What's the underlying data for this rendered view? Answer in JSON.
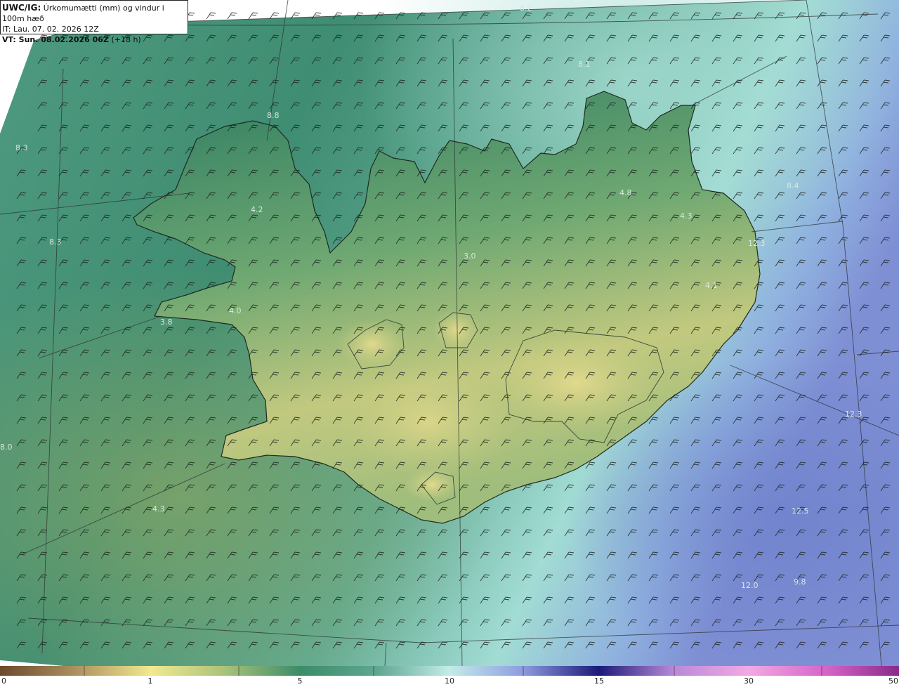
{
  "header": {
    "model": "UWC/IG:",
    "description": "Úrkomumætti (mm) og vindur i 100m hæð",
    "issue_time": "IT: Lau. 07. 02. 2026 12Z",
    "valid_time_bold": "VT: Sun. 08.02.2026 06Z",
    "lead": "(+18 h)"
  },
  "legend": {
    "ticks": [
      "0",
      "1",
      "5",
      "10",
      "15",
      "30",
      "50"
    ]
  },
  "map": {
    "values": [
      "8.2",
      "8.1",
      "8.3",
      "4.8",
      "4.2",
      "8.3",
      "4.3",
      "3.0",
      "8.4",
      "4.1",
      "4.0",
      "3.8",
      "12.3",
      "4.3",
      "12.5",
      "12.0",
      "9.8",
      "8.0",
      "8.8",
      "12.3"
    ]
  },
  "colors": {
    "land_dark": "#2f7a60",
    "land_mid": "#4c9272",
    "land_light": "#b6c77c",
    "land_high": "#d9d68c",
    "sea_near": "#5fa48a",
    "sea_far": "#96d4cc",
    "sea_blue": "#7f9ad6",
    "outside": "#ffffff"
  }
}
